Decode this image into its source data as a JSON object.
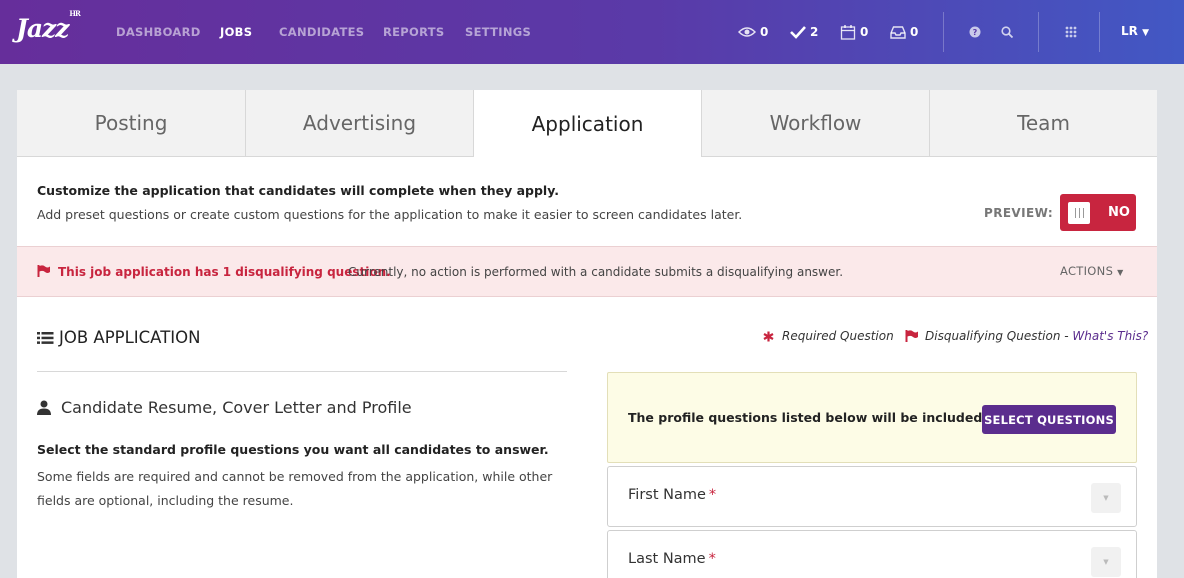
{
  "app": {
    "logo": "Jazz",
    "logo_mark": "HR"
  },
  "nav": {
    "items": [
      "DASHBOARD",
      "JOBS",
      "CANDIDATES",
      "REPORTS",
      "SETTINGS"
    ],
    "active": "JOBS"
  },
  "stats": {
    "views": "0",
    "tasks": "2",
    "events": "0",
    "inbox": "0"
  },
  "user": {
    "initials": "LR"
  },
  "tabs": [
    "Posting",
    "Advertising",
    "Application",
    "Workflow",
    "Team"
  ],
  "active_tab": "Application",
  "intro": {
    "title": "Customize the application that candidates will complete when they apply.",
    "description": "Add preset questions or create custom questions for the application to make it easier to screen candidates later.",
    "preview_label": "PREVIEW:",
    "preview_state": "NO"
  },
  "alert": {
    "strong": "This job application has 1 disqualifying question.",
    "text": "Currently, no action is performed with a candidate submits a disqualifying answer.",
    "actions_label": "ACTIONS"
  },
  "section": {
    "title": "JOB APPLICATION",
    "legend_required": "Required Question",
    "legend_disqualifying": "Disqualifying Question - ",
    "legend_link": "What's This?"
  },
  "profile": {
    "title": "Candidate Resume, Cover Letter and Profile",
    "strong": "Select the standard profile questions you want all candidates to answer.",
    "text": "Some fields are required and cannot be removed from the application, while other fields are optional, including the resume.",
    "notice": "The profile questions listed below will be included.",
    "select_button": "SELECT QUESTIONS",
    "fields": [
      {
        "label": "First Name",
        "required": "*"
      },
      {
        "label": "Last Name",
        "required": "*"
      }
    ]
  },
  "colors": {
    "brand_purple": "#5b2d8e",
    "danger_red": "#c8253f",
    "notice_yellow": "#fdfce6"
  }
}
